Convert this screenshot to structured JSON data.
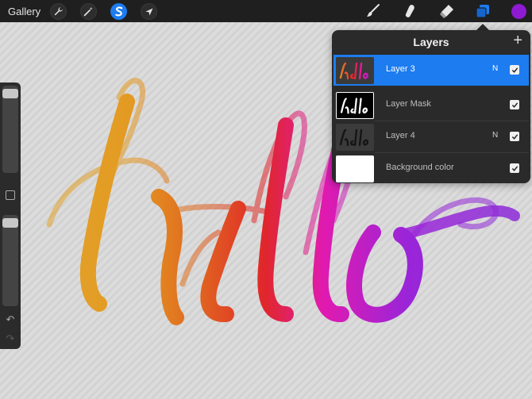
{
  "toolbar": {
    "gallery_label": "Gallery",
    "left_tools": [
      {
        "icon": "wrench-icon"
      },
      {
        "icon": "magic-wand-icon"
      },
      {
        "icon": "selection-icon"
      },
      {
        "icon": "transform-arrow-icon"
      }
    ],
    "right_tools": [
      {
        "icon": "brush-icon"
      },
      {
        "icon": "smudge-icon"
      },
      {
        "icon": "eraser-icon"
      },
      {
        "icon": "layers-icon"
      }
    ],
    "current_color": "#8e1ad1",
    "accent": "#1c7cf0"
  },
  "canvas": {
    "lettering": "hello"
  },
  "sidebar": {
    "brush_size_level": 0.05,
    "opacity_level": 0.05,
    "modify_icon": "square-icon",
    "undo_icon": "undo-icon",
    "redo_icon": "redo-icon"
  },
  "layers_panel": {
    "title": "Layers",
    "add_icon": "plus-icon",
    "layers": [
      {
        "name": "Layer 3",
        "blend": "N",
        "visible": true,
        "selected": true,
        "thumb": "hello-gradient"
      },
      {
        "name": "Layer Mask",
        "blend": "",
        "visible": true,
        "selected": false,
        "thumb": "hello-mask"
      },
      {
        "name": "Layer 4",
        "blend": "N",
        "visible": true,
        "selected": false,
        "thumb": "hello-dark"
      },
      {
        "name": "Background color",
        "blend": "",
        "visible": true,
        "selected": false,
        "thumb": "white"
      }
    ]
  }
}
